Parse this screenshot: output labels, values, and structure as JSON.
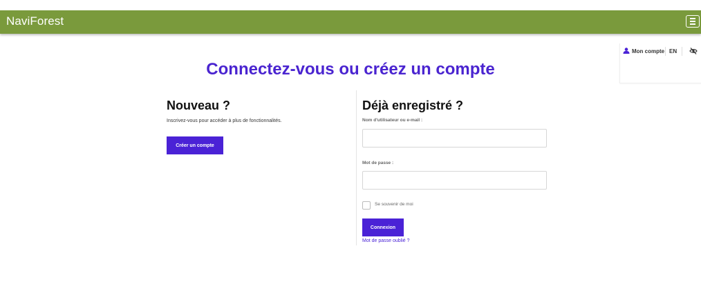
{
  "navbar": {
    "brand": "NaviForest",
    "menu_icon": "hamburger-icon",
    "background_color": "#7a9a3c"
  },
  "utility": {
    "account_icon": "user-icon",
    "account_label": "Mon compte",
    "language": "EN",
    "accessibility_icon": "eye-slash-icon"
  },
  "page": {
    "title": "Connectez-vous ou créez un compte",
    "accent_color": "#4a22d6"
  },
  "new_customer": {
    "heading": "Nouveau ?",
    "description": "Inscrivez-vous pour accéder à plus de fonctionnalités.",
    "create_button": "Créer un compte"
  },
  "login": {
    "heading": "Déjà enregistré ?",
    "username_label": "Nom d'utilisateur ou e-mail :",
    "username_value": "",
    "password_label": "Mot de passe :",
    "password_value": "",
    "remember_label": "Se souvenir de moi",
    "remember_checked": false,
    "submit_button": "Connexion",
    "forgot_link": "Mot de passe oublié ?"
  }
}
